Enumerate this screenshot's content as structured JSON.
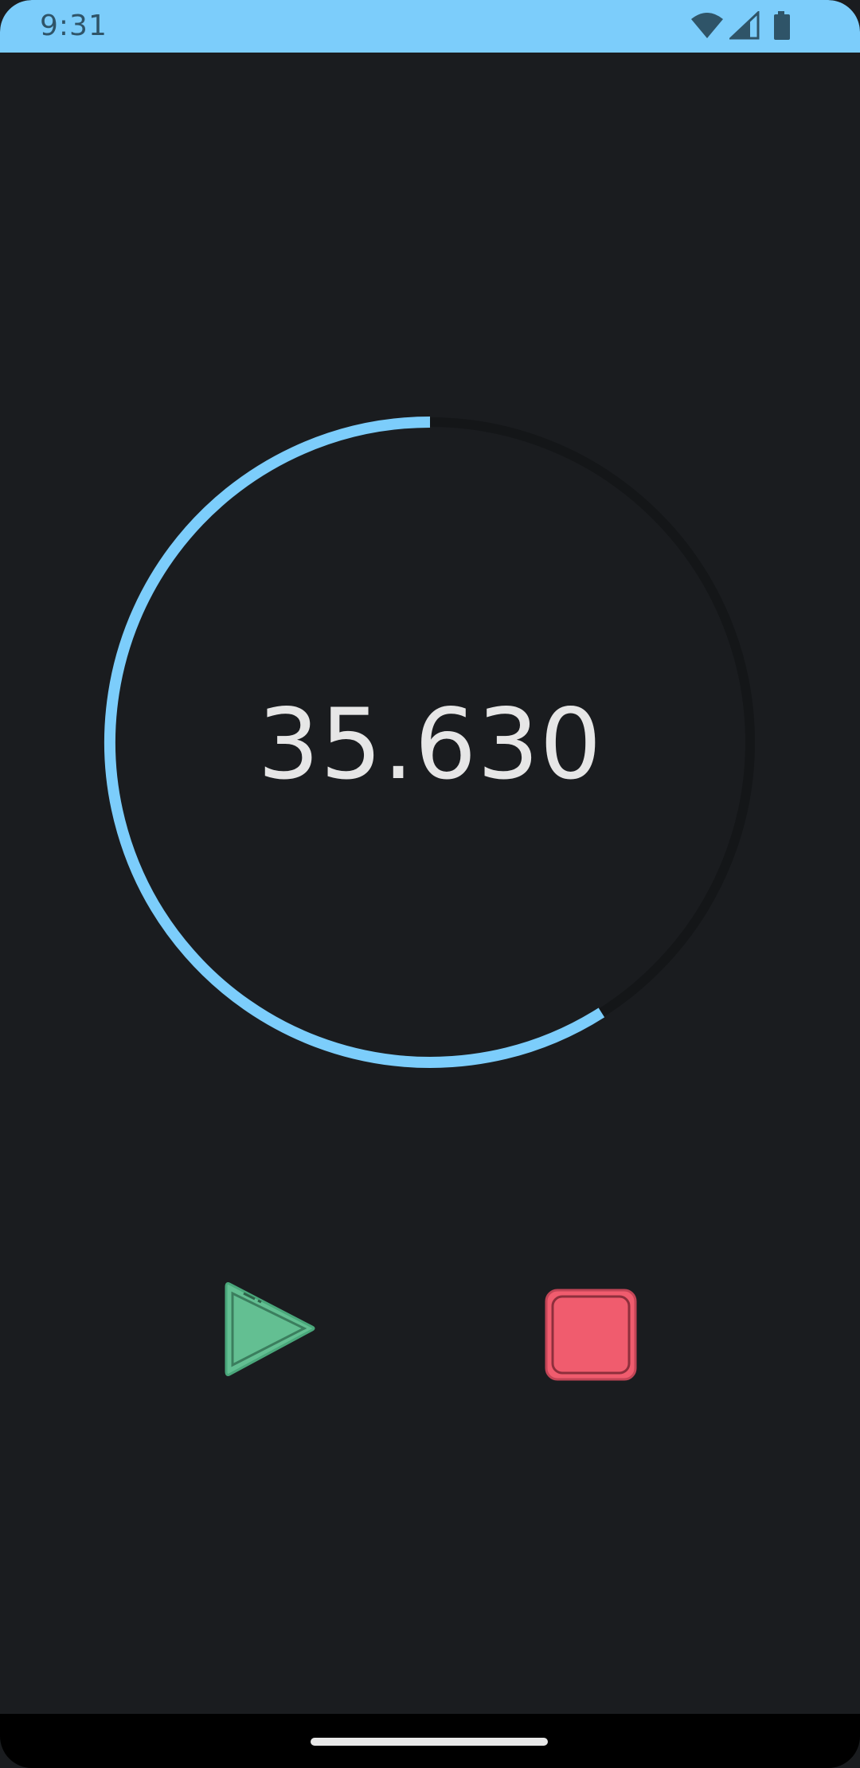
{
  "status_bar": {
    "time": "9:31",
    "icons": [
      "wifi-icon",
      "signal-icon",
      "battery-icon"
    ],
    "color": "#7ccdfb",
    "icon_color": "#2f5468"
  },
  "timer": {
    "value": "35.630",
    "progress_fraction": 0.59,
    "ring_color": "#7ccdfb",
    "track_color": "#141618"
  },
  "controls": {
    "play": {
      "icon": "play-icon",
      "color": "#63bf92"
    },
    "stop": {
      "icon": "stop-icon",
      "color": "#f05c6e"
    }
  },
  "nav": {
    "home_handle": "home-handle"
  }
}
